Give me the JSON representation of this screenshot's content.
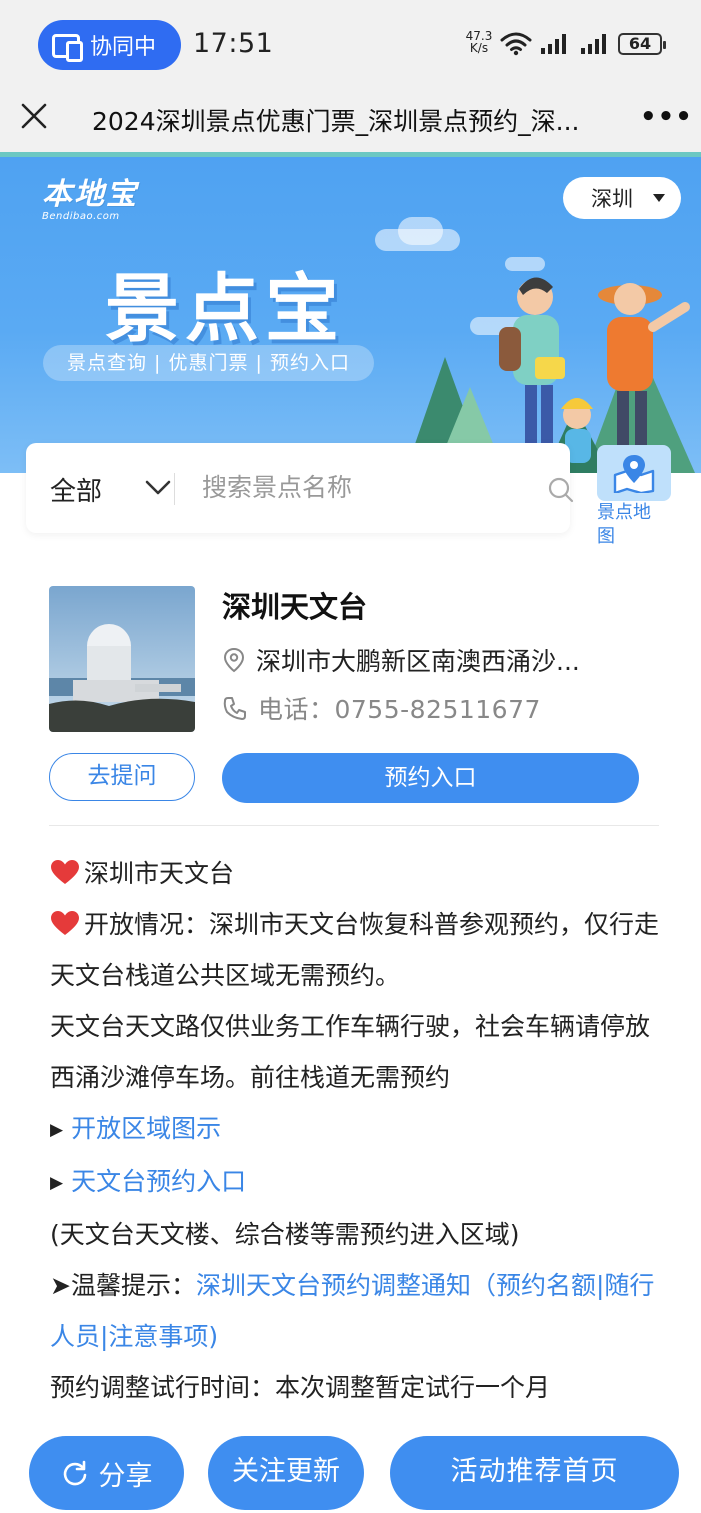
{
  "status_bar": {
    "collab_label": "协同中",
    "time": "17:51",
    "net_speed_value": "47.3",
    "net_speed_unit": "K/s",
    "battery": "64"
  },
  "title_bar": {
    "title": "2024深圳景点优惠门票_深圳景点预约_深..."
  },
  "banner": {
    "logo_cn": "本地宝",
    "logo_en": "Bendibao.com",
    "city": "深圳",
    "title": "景点宝",
    "subtitle": "景点查询 | 优惠门票 | 预约入口"
  },
  "search": {
    "category": "全部",
    "placeholder": "搜索景点名称"
  },
  "map_button": {
    "label": "景点地图"
  },
  "spot": {
    "name": "深圳天文台",
    "address": "深圳市大鹏新区南澳西涌沙...",
    "phone": "电话：0755-82511677",
    "ask_label": "去提问",
    "book_label": "预约入口"
  },
  "article": {
    "line1": "深圳市天文台",
    "line2_prefix": "开放情况：深圳市天文台恢复科普参观预约，仅行走天文台栈道公共区域无需预约。",
    "line3": "天文台天文路仅供业务工作车辆行驶，社会车辆请停放西涌沙滩停车场。前往栈道无需预约",
    "link1": "开放区域图示",
    "link2": "天文台预约入口",
    "line4": "(天文台天文楼、综合楼等需预约进入区域)",
    "tip_label": "➤温馨提示：",
    "tip_link": "深圳天文台预约调整通知（预约名额|随行人员|注意事项)",
    "line5": "预约调整试行时间：本次调整暂定试行一个月"
  },
  "bottom_bar": {
    "share": "分享",
    "follow": "关注更新",
    "home": "活动推荐首页"
  },
  "colors": {
    "accent": "#3f8ef0",
    "link": "#3a86e6",
    "collab": "#2f6cf2",
    "banner": "#5aaaf3"
  },
  "icons": [
    "screen-share-icon",
    "wifi-icon",
    "signal-icon",
    "battery-icon",
    "close-icon",
    "more-icon",
    "chevron-down-icon",
    "search-icon",
    "map-icon",
    "location-pin-icon",
    "phone-icon",
    "heart-icon",
    "refresh-icon"
  ]
}
